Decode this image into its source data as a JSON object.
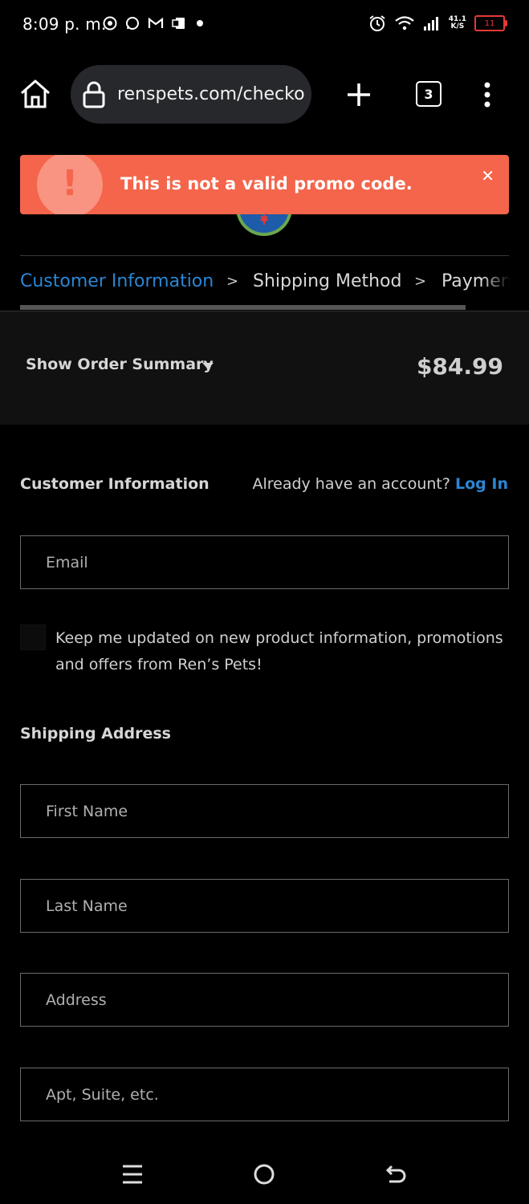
{
  "status_bar": {
    "time": "8:09 p. m.",
    "net_speed_value": "41.1",
    "net_speed_unit": "K/S",
    "battery": "11"
  },
  "browser": {
    "url": "renspets.com/checko",
    "tab_count": "3"
  },
  "alert": {
    "icon": "!",
    "message": "This is not a valid promo code.",
    "close": "✕"
  },
  "stepper": {
    "steps": [
      "Customer Information",
      "Shipping Method",
      "Payment"
    ],
    "separator": ">"
  },
  "order_summary": {
    "toggle_label": "Show Order Summary",
    "total": "$84.99"
  },
  "customer_info": {
    "title": "Customer Information",
    "account_prompt": "Already have an account?",
    "login_label": "Log In",
    "email_placeholder": "Email",
    "newsletter_label": "Keep me updated on new product information, promotions and offers from Ren’s Pets!"
  },
  "shipping_address": {
    "title": "Shipping Address",
    "first_name_placeholder": "First Name",
    "last_name_placeholder": "Last Name",
    "address_placeholder": "Address",
    "apt_placeholder": "Apt, Suite, etc."
  },
  "colors": {
    "accent": "#2b86d4",
    "alert": "#f4654b",
    "background": "#000000"
  }
}
